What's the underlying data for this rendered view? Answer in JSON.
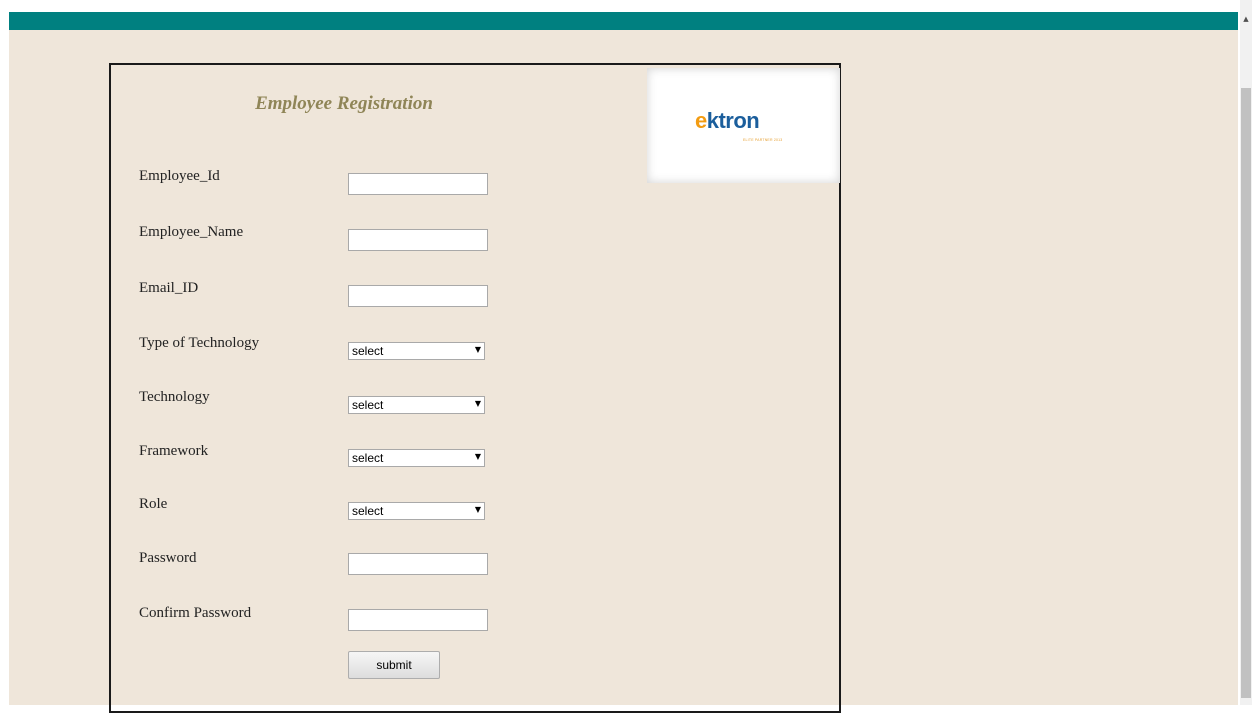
{
  "form": {
    "title": "Employee Registration",
    "fields": [
      {
        "label": "Employee_Id",
        "value": ""
      },
      {
        "label": "Employee_Name",
        "value": ""
      },
      {
        "label": "Email_ID",
        "value": ""
      },
      {
        "label": "Type of Technology",
        "value": "select"
      },
      {
        "label": "Technology",
        "value": "select"
      },
      {
        "label": "Framework",
        "value": "select"
      },
      {
        "label": "Role",
        "value": "select"
      },
      {
        "label": "Password",
        "value": ""
      },
      {
        "label": "Confirm Password",
        "value": ""
      }
    ],
    "submit_label": "submit"
  },
  "logo": {
    "brand_first": "e",
    "brand_rest": "ktron",
    "tagline": "ELITE PARTNER 2013"
  },
  "colors": {
    "header_bar": "#008080",
    "page_background": "#efe6da",
    "title": "#8f8557",
    "logo_orange": "#f39c12",
    "logo_blue": "#1b5e9c"
  },
  "icons": {
    "dropdown": "triangle-down",
    "scroll_up": "triangle-up"
  }
}
